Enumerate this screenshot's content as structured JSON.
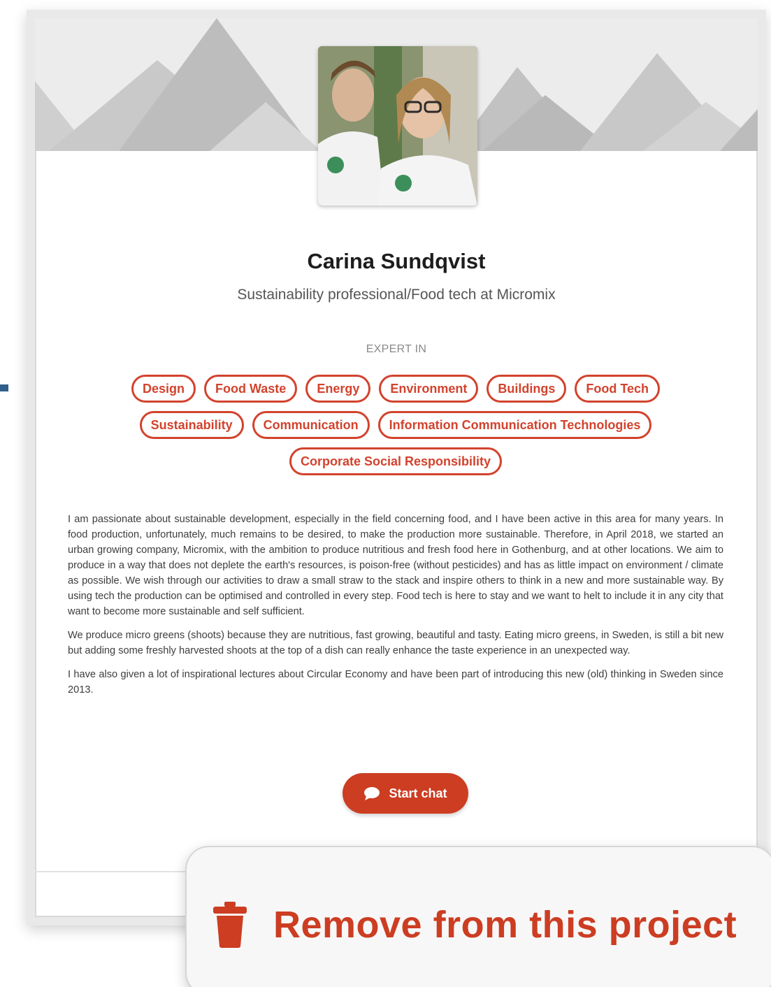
{
  "profile": {
    "name": "Carina Sundqvist",
    "headline": "Sustainability professional/Food tech at Micromix",
    "expert_label": "EXPERT IN",
    "tags": [
      "Design",
      "Food Waste",
      "Energy",
      "Environment",
      "Buildings",
      "Food Tech",
      "Sustainability",
      "Communication",
      "Information Communication Technologies",
      "Corporate Social Responsibility"
    ],
    "bio": [
      "I am passionate about sustainable development, especially in the field concerning food, and I have been active in this area for many years. In food production, unfortunately, much remains to be desired, to make the production more sustainable. Therefore, in April 2018, we started an urban growing company, Micromix, with the ambition to produce nutritious and fresh food here in Gothenburg, and at other locations. We aim to produce in a way that does not deplete the earth's resources, is poison-free (without pesticides) and has as little impact on environment / climate as possible. We wish through our activities to draw a small straw to the stack and inspire others to think in a new and more sustainable way. By using tech the production can be optimised and controlled in every step. Food tech is here to stay and we want to helt to include it in any city that want to become more sustainable and self sufficient.",
      "We produce micro greens (shoots) because they are nutritious, fast growing, beautiful and tasty. Eating micro greens, in Sweden, is still a bit new but adding some freshly harvested shoots at the top of a dish can really enhance the taste experience in an unexpected way.",
      "I have also given a lot of inspirational lectures about Circular Economy and have been part of introducing this new (old) thinking in Sweden since 2013."
    ]
  },
  "actions": {
    "start_chat": "Start chat",
    "remove": "Remove from this project"
  },
  "icons": {
    "chat": "chat-bubble-icon",
    "remove": "trash-icon"
  },
  "colors": {
    "accent": "#cc3d22",
    "tag": "#d2432d"
  }
}
